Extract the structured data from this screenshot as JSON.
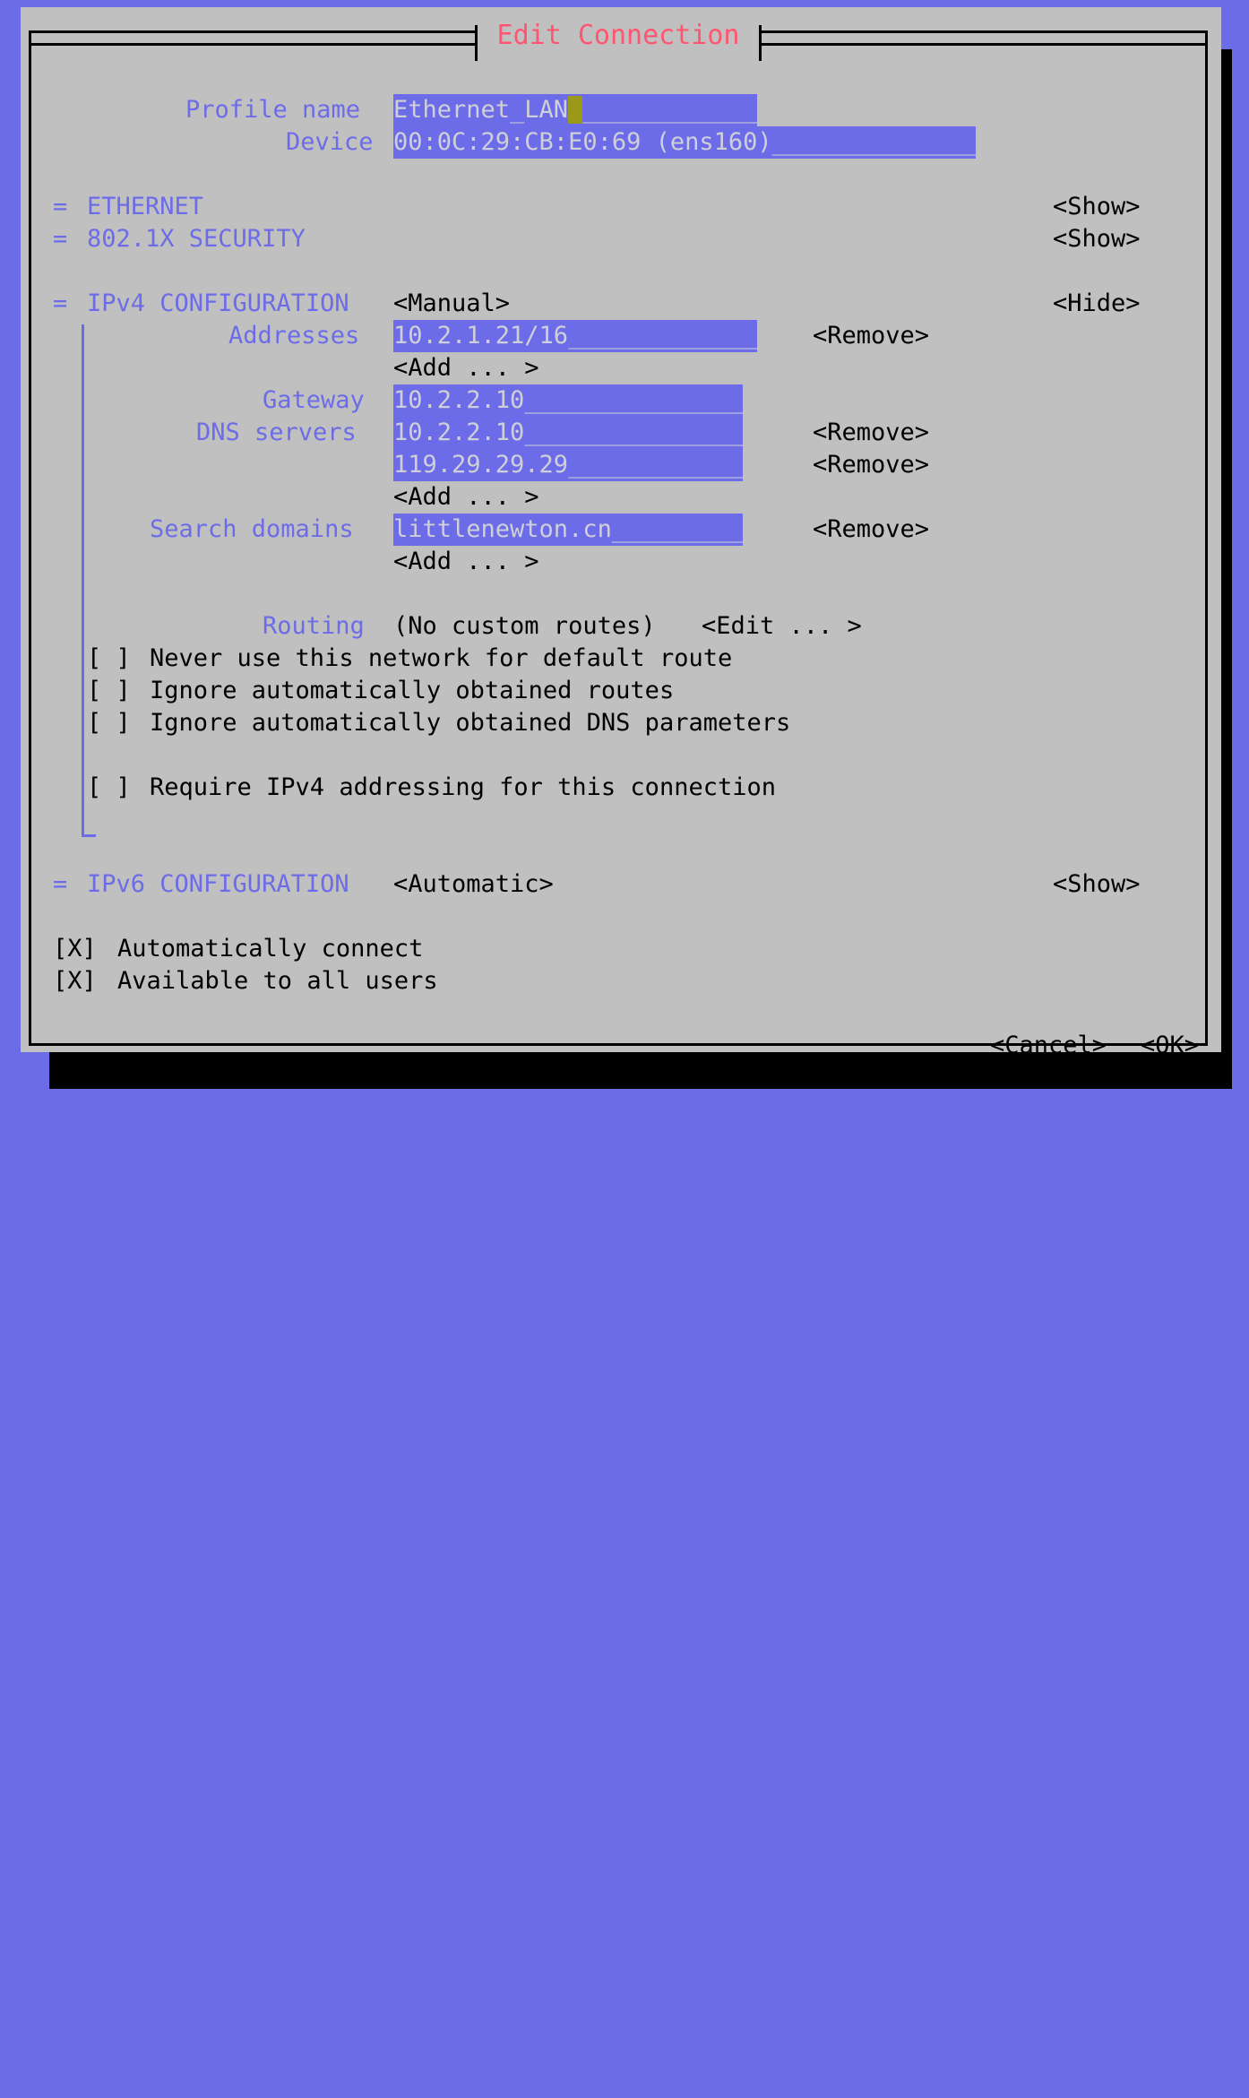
{
  "window": {
    "title": "Edit Connection",
    "title_color": "#ff5570",
    "bg_color": "#c0c0c0",
    "desktop_color": "#6c6ce8",
    "accent_color": "#6c6ce8",
    "cursor_color": "#9a9a18"
  },
  "header": {
    "profile_name_label": "Profile name",
    "profile_name_value": "Ethernet_LAN",
    "profile_name_cursor": " ",
    "profile_name_pad": "____________",
    "device_label": "Device",
    "device_value": "00:0C:29:CB:E0:69 (ens160)",
    "device_pad": "______________"
  },
  "sections": {
    "ethernet": {
      "marker": "=",
      "label": "ETHERNET",
      "toggle": "<Show>"
    },
    "security_8021x": {
      "marker": "=",
      "label": "802.1X SECURITY",
      "toggle": "<Show>"
    },
    "ipv4": {
      "marker": "=",
      "label": "IPv4 CONFIGURATION",
      "method": "<Manual>",
      "toggle": "<Hide>",
      "addresses_label": "Addresses",
      "addresses": [
        {
          "value": "10.2.1.21/16",
          "pad": "_____________",
          "remove": "<Remove>"
        }
      ],
      "addresses_add": "<Add ... >",
      "gateway_label": "Gateway",
      "gateway_value": "10.2.2.10",
      "gateway_pad": "_______________",
      "dns_label": "DNS servers",
      "dns_servers": [
        {
          "value": "10.2.2.10",
          "pad": "_______________",
          "remove": "<Remove>"
        },
        {
          "value": "119.29.29.29",
          "pad": "____________",
          "remove": "<Remove>"
        }
      ],
      "dns_add": "<Add ... >",
      "search_label": "Search domains",
      "search_domains": [
        {
          "value": "littlenewton.cn",
          "pad": "_________",
          "remove": "<Remove>"
        }
      ],
      "search_add": "<Add ... >",
      "routing_label": "Routing",
      "routing_value": "(No custom routes)",
      "routing_edit": "<Edit ... >",
      "checkboxes": [
        {
          "box": "[ ]",
          "label": "Never use this network for default route",
          "checked": false
        },
        {
          "box": "[ ]",
          "label": "Ignore automatically obtained routes",
          "checked": false
        },
        {
          "box": "[ ]",
          "label": "Ignore automatically obtained DNS parameters",
          "checked": false
        },
        {
          "box": "[ ]",
          "label": "Require IPv4 addressing for this connection",
          "checked": false
        }
      ]
    },
    "ipv6": {
      "marker": "=",
      "label": "IPv6 CONFIGURATION",
      "method": "<Automatic>",
      "toggle": "<Show>"
    }
  },
  "footer": {
    "checkboxes": [
      {
        "box": "[X]",
        "label": "Automatically connect",
        "checked": true
      },
      {
        "box": "[X]",
        "label": "Available to all users",
        "checked": true
      }
    ],
    "cancel": "<Cancel>",
    "ok": "<OK>"
  }
}
